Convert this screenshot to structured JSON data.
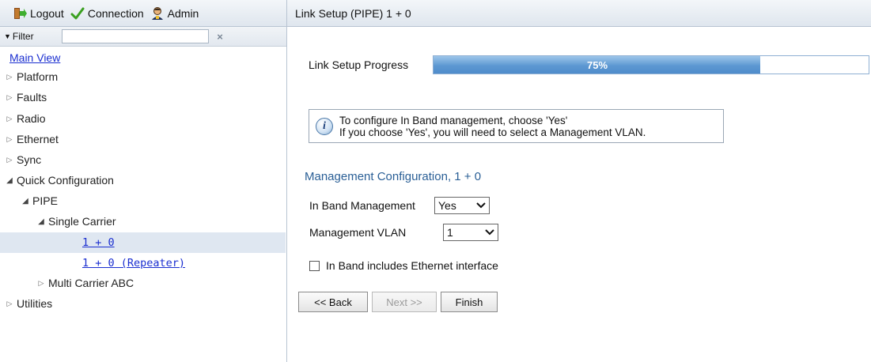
{
  "toolbar": {
    "logout_label": "Logout",
    "connection_label": "Connection",
    "admin_label": "Admin"
  },
  "filter": {
    "label": "Filter",
    "value": "",
    "clear_icon": "×"
  },
  "tree": {
    "main_view": "Main View",
    "platform": "Platform",
    "faults": "Faults",
    "radio": "Radio",
    "ethernet": "Ethernet",
    "sync": "Sync",
    "quick_configuration": "Quick Configuration",
    "pipe": "PIPE",
    "single_carrier": "Single Carrier",
    "one_plus_zero": "1 + 0",
    "one_plus_zero_repeater": "1 + 0 (Repeater)",
    "multi_carrier_abc": "Multi Carrier ABC",
    "utilities": "Utilities"
  },
  "header": {
    "title": "Link Setup (PIPE) 1 + 0"
  },
  "progress": {
    "label": "Link Setup Progress",
    "percent_text": "75%",
    "fraction": 0.75
  },
  "info": {
    "line1": "To configure In Band management, choose 'Yes'",
    "line2": "If you choose 'Yes', you will need to select a Management VLAN."
  },
  "management": {
    "section_title": "Management Configuration, 1 + 0",
    "in_band_label": "In Band Management",
    "in_band_value": "Yes",
    "vlan_label": "Management VLAN",
    "vlan_value": "1",
    "checkbox_label": "In Band includes Ethernet interface",
    "checkbox_checked": false
  },
  "buttons": {
    "back": "<< Back",
    "next": "Next >>",
    "finish": "Finish"
  },
  "colors": {
    "accent": "#2a5f96",
    "link": "#1a2ed0",
    "progress": "#5d98d2",
    "selected_row": "#dfe7f1"
  }
}
